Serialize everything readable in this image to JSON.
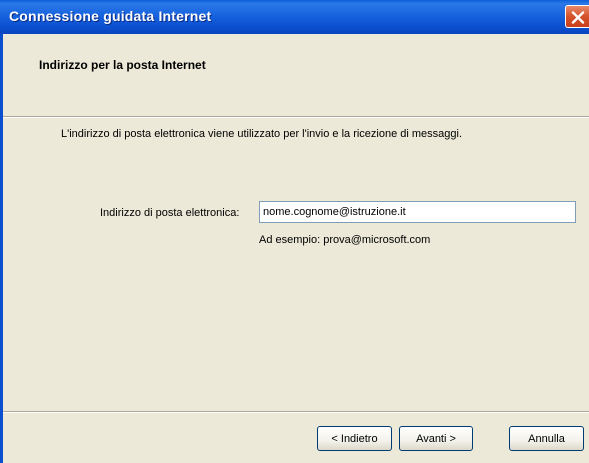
{
  "window": {
    "title": "Connessione guidata Internet",
    "close_icon": "close-icon"
  },
  "header": {
    "heading": "Indirizzo per la posta Internet"
  },
  "body": {
    "description": "L'indirizzo di posta elettronica viene utilizzato per l'invio e la ricezione di messaggi.",
    "email_label": "Indirizzo di posta elettronica:",
    "email_value": "nome.cognome@istruzione.it",
    "example": "Ad esempio: prova@microsoft.com"
  },
  "buttons": {
    "back": "< Indietro",
    "next": "Avanti >",
    "cancel": "Annulla"
  },
  "colors": {
    "titlebar": "#0b4fce",
    "dialog_bg": "#ece9d8",
    "close_button": "#d5522a"
  }
}
